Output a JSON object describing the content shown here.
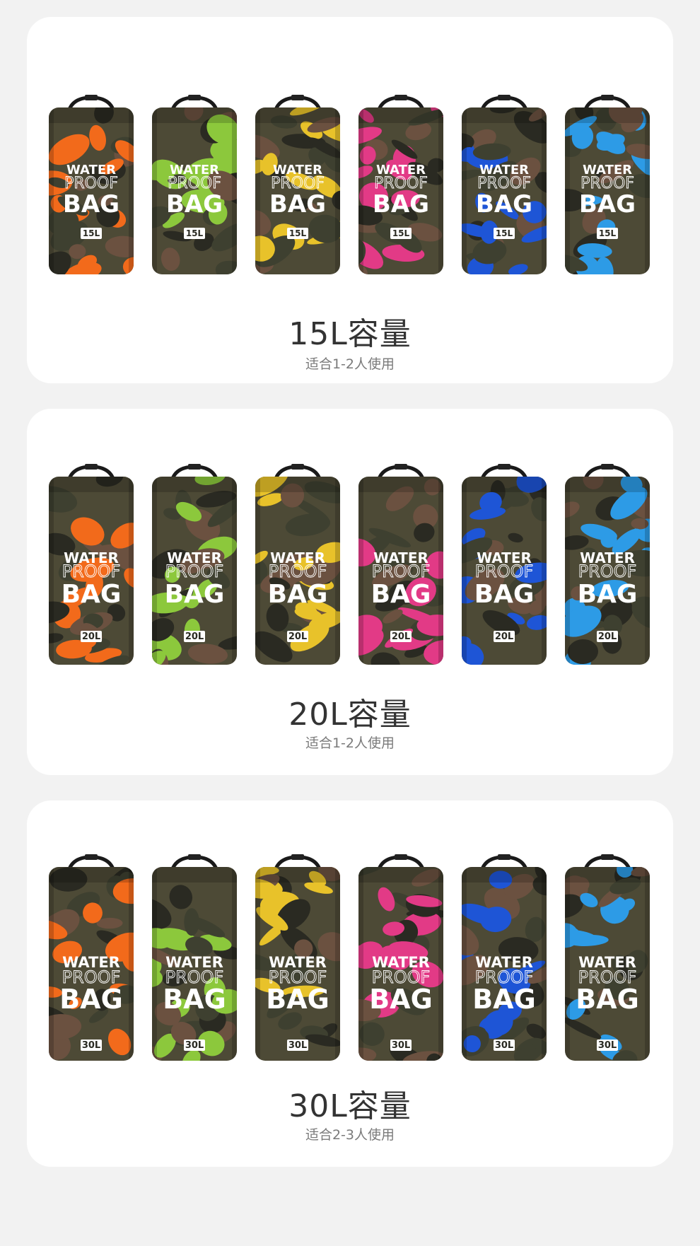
{
  "sections": [
    {
      "title": "15L容量",
      "subtitle": "适合1-2人使用",
      "bags": [
        {
          "line1": "WATER",
          "line2": "PROOF",
          "line3": "BAG",
          "size": "15L",
          "color": "#f26a1b",
          "name": "orange"
        },
        {
          "line1": "WATER",
          "line2": "PROOF",
          "line3": "BAG",
          "size": "15L",
          "color": "#8cc83c",
          "name": "green"
        },
        {
          "line1": "WATER",
          "line2": "PROOF",
          "line3": "BAG",
          "size": "15L",
          "color": "#e8c22a",
          "name": "yellow"
        },
        {
          "line1": "WATER",
          "line2": "PROOF",
          "line3": "BAG",
          "size": "15L",
          "color": "#e23a86",
          "name": "pink"
        },
        {
          "line1": "WATER",
          "line2": "PROOF",
          "line3": "BAG",
          "size": "15L",
          "color": "#1e55d6",
          "name": "blue"
        },
        {
          "line1": "WATER",
          "line2": "PROOF",
          "line3": "BAG",
          "size": "15L",
          "color": "#2d9be6",
          "name": "sky-blue"
        }
      ]
    },
    {
      "title": "20L容量",
      "subtitle": "适合1-2人使用",
      "bags": [
        {
          "line1": "WATER",
          "line2": "PROOF",
          "line3": "BAG",
          "size": "20L",
          "color": "#f26a1b",
          "name": "orange"
        },
        {
          "line1": "WATER",
          "line2": "PROOF",
          "line3": "BAG",
          "size": "20L",
          "color": "#8cc83c",
          "name": "green"
        },
        {
          "line1": "WATER",
          "line2": "PROOF",
          "line3": "BAG",
          "size": "20L",
          "color": "#e8c22a",
          "name": "yellow"
        },
        {
          "line1": "WATER",
          "line2": "PROOF",
          "line3": "BAG",
          "size": "20L",
          "color": "#e23a86",
          "name": "pink"
        },
        {
          "line1": "WATER",
          "line2": "PROOF",
          "line3": "BAG",
          "size": "20L",
          "color": "#1e55d6",
          "name": "blue"
        },
        {
          "line1": "WATER",
          "line2": "PROOF",
          "line3": "BAG",
          "size": "20L",
          "color": "#2d9be6",
          "name": "sky-blue"
        }
      ]
    },
    {
      "title": "30L容量",
      "subtitle": "适合2-3人使用",
      "bags": [
        {
          "line1": "WATER",
          "line2": "PROOF",
          "line3": "BAG",
          "size": "30L",
          "color": "#f26a1b",
          "name": "orange"
        },
        {
          "line1": "WATER",
          "line2": "PROOF",
          "line3": "BAG",
          "size": "30L",
          "color": "#8cc83c",
          "name": "green"
        },
        {
          "line1": "WATER",
          "line2": "PROOF",
          "line3": "BAG",
          "size": "30L",
          "color": "#e8c22a",
          "name": "yellow"
        },
        {
          "line1": "WATER",
          "line2": "PROOF",
          "line3": "BAG",
          "size": "30L",
          "color": "#e23a86",
          "name": "pink"
        },
        {
          "line1": "WATER",
          "line2": "PROOF",
          "line3": "BAG",
          "size": "30L",
          "color": "#1e55d6",
          "name": "blue"
        },
        {
          "line1": "WATER",
          "line2": "PROOF",
          "line3": "BAG",
          "size": "30L",
          "color": "#2d9be6",
          "name": "sky-blue"
        }
      ]
    }
  ]
}
